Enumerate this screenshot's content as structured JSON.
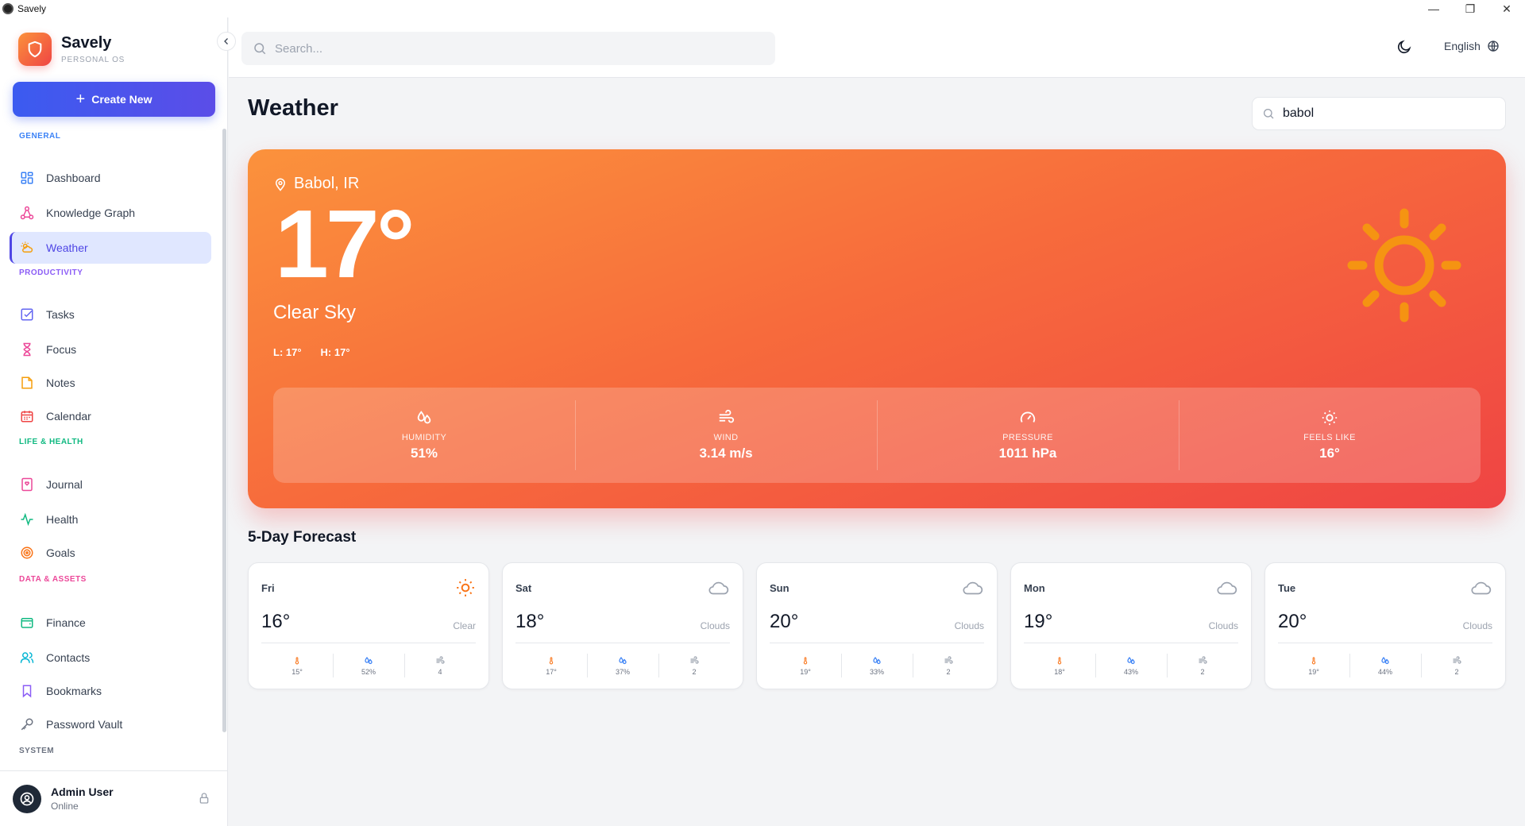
{
  "window": {
    "title": "Savely",
    "minimize": "—",
    "restore": "❐",
    "close": "✕"
  },
  "brand": {
    "name": "Savely",
    "subtitle": "PERSONAL OS"
  },
  "sidebar": {
    "create_label": "Create New",
    "sections": {
      "general": "GENERAL",
      "productivity": "PRODUCTIVITY",
      "life": "LIFE & HEALTH",
      "data": "DATA & ASSETS",
      "system": "SYSTEM"
    },
    "items": {
      "dashboard": "Dashboard",
      "knowledge_graph": "Knowledge Graph",
      "weather": "Weather",
      "tasks": "Tasks",
      "focus": "Focus",
      "notes": "Notes",
      "calendar": "Calendar",
      "journal": "Journal",
      "health": "Health",
      "goals": "Goals",
      "finance": "Finance",
      "contacts": "Contacts",
      "bookmarks": "Bookmarks",
      "password_vault": "Password Vault"
    },
    "user": {
      "name": "Admin User",
      "status": "Online"
    }
  },
  "topbar": {
    "search_placeholder": "Search...",
    "language": "English"
  },
  "page": {
    "title": "Weather",
    "city_query": "babol"
  },
  "current": {
    "location": "Babol, IR",
    "temperature": "17°",
    "condition": "Clear Sky",
    "low": "L: 17°",
    "high": "H: 17°",
    "stats": {
      "humidity": {
        "label": "HUMIDITY",
        "value": "51%"
      },
      "wind": {
        "label": "WIND",
        "value": "3.14 m/s"
      },
      "pressure": {
        "label": "PRESSURE",
        "value": "1011 hPa"
      },
      "feels_like": {
        "label": "FEELS LIKE",
        "value": "16°"
      }
    }
  },
  "forecast": {
    "title": "5-Day Forecast",
    "days": [
      {
        "day": "Fri",
        "temp": "16°",
        "desc": "Clear",
        "icon": "sun-icon",
        "t": "15°",
        "humidity": "52%",
        "wind": "4"
      },
      {
        "day": "Sat",
        "temp": "18°",
        "desc": "Clouds",
        "icon": "cloud-icon",
        "t": "17°",
        "humidity": "37%",
        "wind": "2"
      },
      {
        "day": "Sun",
        "temp": "20°",
        "desc": "Clouds",
        "icon": "cloud-icon",
        "t": "19°",
        "humidity": "33%",
        "wind": "2"
      },
      {
        "day": "Mon",
        "temp": "19°",
        "desc": "Clouds",
        "icon": "cloud-icon",
        "t": "18°",
        "humidity": "43%",
        "wind": "2"
      },
      {
        "day": "Tue",
        "temp": "20°",
        "desc": "Clouds",
        "icon": "cloud-icon",
        "t": "19°",
        "humidity": "44%",
        "wind": "2"
      }
    ]
  },
  "colors": {
    "accent": "#4f46e5",
    "hero_start": "#fb923c",
    "hero_end": "#ef4444",
    "section_general": "#3b82f6",
    "section_productivity": "#8b5cf6",
    "section_life": "#10b981",
    "section_data": "#ec4899",
    "section_system": "#6b7280"
  }
}
